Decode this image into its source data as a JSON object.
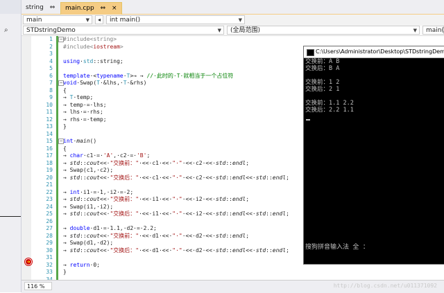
{
  "tabs": [
    {
      "label": "string",
      "pin": "⇔"
    },
    {
      "label": "main.cpp",
      "pin": "⇔",
      "close": "×"
    }
  ],
  "nav": {
    "project_selected": "main",
    "function_selected": "int main()"
  },
  "scope": {
    "project": "STDstringDemo",
    "scope": "(全局范围)",
    "member": "main()"
  },
  "code_lines": [
    {
      "no": "1",
      "html": "<span class=\"pre\">#include&lt;string&gt;</span>"
    },
    {
      "no": "2",
      "html": "<span class=\"pre\">#include&lt;</span><span class=\"str\">iostream</span><span class=\"pre\">&gt;</span>"
    },
    {
      "no": "3",
      "html": ""
    },
    {
      "no": "4",
      "html": "<span class=\"kw\">using</span>·<span class=\"ty\">std</span>::string;"
    },
    {
      "no": "5",
      "html": ""
    },
    {
      "no": "6",
      "html": "<span class=\"kw\">template</span>·&lt;<span class=\"kw\">typename</span>·<span class=\"ty\">T</span>&gt;→ → <span class=\"cm\">//·此时的·T·就相当于一个占位符</span>"
    },
    {
      "no": "7",
      "html": "<span class=\"kw\">void</span>·Swap(<span class=\"ty\">T</span>·&amp;lhs,·<span class=\"ty\">T</span>·&amp;rhs)"
    },
    {
      "no": "8",
      "html": "{"
    },
    {
      "no": "9",
      "html": "→ <span class=\"ty\">T</span>·temp;"
    },
    {
      "no": "10",
      "html": "→ temp·=·lhs;"
    },
    {
      "no": "11",
      "html": "→ lhs·=·rhs;"
    },
    {
      "no": "12",
      "html": "→ rhs·=·temp;"
    },
    {
      "no": "13",
      "html": "}"
    },
    {
      "no": "14",
      "html": ""
    },
    {
      "no": "15",
      "html": "<span class=\"kw\">int</span>·<i>main</i>()"
    },
    {
      "no": "16",
      "html": "{"
    },
    {
      "no": "17",
      "html": "→ <span class=\"kw\">char</span>·c1·=·<span class=\"str\">'A'</span>,·c2·=·<span class=\"str\">'B'</span>;"
    },
    {
      "no": "18",
      "html": "→ <i>std</i>::<i>cout</i>&lt;&lt;·<span class=\"str\">\"交换前：\"</span>·&lt;&lt;·c1·&lt;&lt;·<span class=\"str\">\"·\"</span>·&lt;&lt;·c2·&lt;&lt;·<i>std</i>::<i>endl</i>;"
    },
    {
      "no": "19",
      "html": "→ Swap(c1,·c2);"
    },
    {
      "no": "20",
      "html": "→ <i>std</i>::<i>cout</i>&lt;&lt;·<span class=\"str\">\"交换后：\"</span>·&lt;&lt;·c1·&lt;&lt;·<span class=\"str\">\"·\"</span>·&lt;&lt;·c2·&lt;&lt;·<i>std</i>::<i>endl</i>&lt;&lt;·<i>std</i>::<i>endl</i>;"
    },
    {
      "no": "21",
      "html": ""
    },
    {
      "no": "22",
      "html": "→ <span class=\"kw\">int</span>·i1·=·1,·i2·=·2;"
    },
    {
      "no": "23",
      "html": "→ <i>std</i>::<i>cout</i>&lt;&lt;·<span class=\"str\">\"交换前：\"</span>·&lt;&lt;·i1·&lt;&lt;·<span class=\"str\">\"·\"</span>·&lt;&lt;·i2·&lt;&lt;·<i>std</i>::<i>endl</i>;"
    },
    {
      "no": "24",
      "html": "→ Swap(i1,·i2);"
    },
    {
      "no": "25",
      "html": "→ <i>std</i>::<i>cout</i>&lt;&lt;·<span class=\"str\">\"交换后：\"</span>·&lt;&lt;·i1·&lt;&lt;·<span class=\"str\">\"·\"</span>·&lt;&lt;·i2·&lt;&lt;·<i>std</i>::<i>endl</i>&lt;&lt;·<i>std</i>::<i>endl</i>;"
    },
    {
      "no": "26",
      "html": ""
    },
    {
      "no": "27",
      "html": "→ <span class=\"kw\">double</span>·d1·=·1.1,·d2·=·2.2;"
    },
    {
      "no": "28",
      "html": "→ <i>std</i>::<i>cout</i>&lt;&lt;·<span class=\"str\">\"交换前：\"</span>·&lt;&lt;·d1·&lt;&lt;·<span class=\"str\">\"·\"</span>·&lt;&lt;·d2·&lt;&lt;·<i>std</i>::<i>endl</i>;"
    },
    {
      "no": "29",
      "html": "→ Swap(d1,·d2);"
    },
    {
      "no": "30",
      "html": "→ <i>std</i>::<i>cout</i>&lt;&lt;·<span class=\"str\">\"交换后：\"</span>·&lt;&lt;·d1·&lt;&lt;·<span class=\"str\">\"·\"</span>·&lt;&lt;·d2·&lt;&lt;·<i>std</i>::<i>endl</i>&lt;&lt;·<i>std</i>::<i>endl</i>;"
    },
    {
      "no": "31",
      "html": ""
    },
    {
      "no": "32",
      "html": "→ <span class=\"kw\">return</span>·0;"
    },
    {
      "no": "33",
      "html": "}"
    },
    {
      "no": "34",
      "html": ""
    }
  ],
  "console": {
    "title": "C:\\Users\\Administrator\\Desktop\\STDstringDemo\\Debug",
    "lines": [
      "交换前：A B",
      "交换后：B A",
      "",
      "交换前：1 2",
      "交换后：2 1",
      "",
      "交换前：1.1 2.2",
      "交换后：2.2 1.1"
    ],
    "ime": "搜狗拼音输入法 全 ："
  },
  "status": {
    "zoom": "116 %",
    "watermark": "http://blog.csdn.net/u011371092"
  },
  "icons": {
    "search": "⌕",
    "dropdown": "▼",
    "fold_minus": "−",
    "breakpoint_arrow": "➜",
    "nav_left": "◂"
  }
}
